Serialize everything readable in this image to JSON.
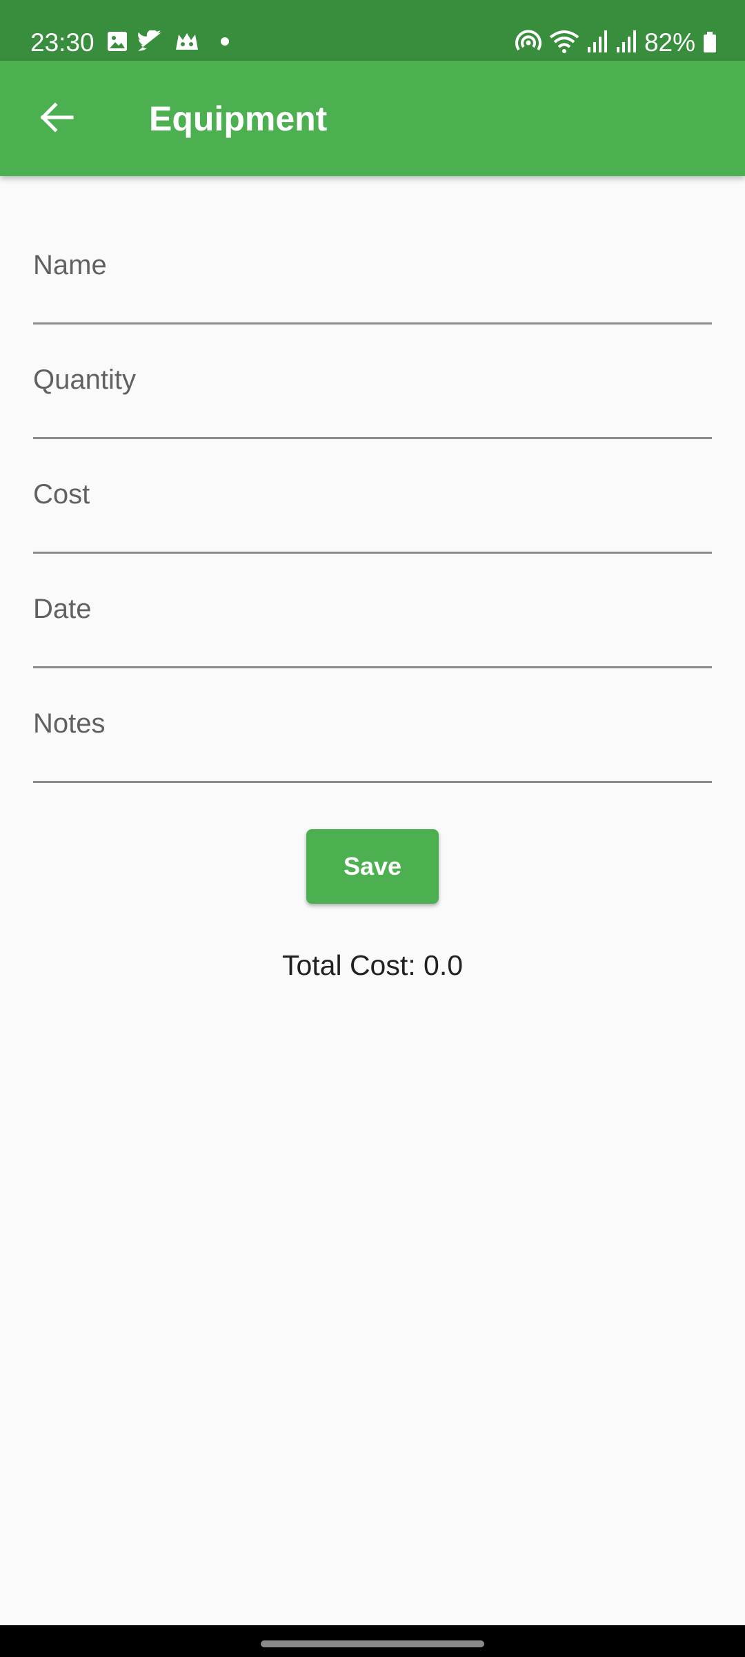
{
  "status_bar": {
    "time": "23:30",
    "battery_text": "82%",
    "icons_left": [
      "gallery-icon",
      "twitter-icon",
      "app-notification-icon",
      "dot-icon"
    ],
    "icons_right": [
      "hotspot-icon",
      "wifi-icon",
      "signal-icon",
      "signal-icon",
      "battery-icon"
    ]
  },
  "app_bar": {
    "title": "Equipment",
    "back_icon": "arrow-back-icon"
  },
  "form": {
    "fields": [
      {
        "label": "Name",
        "value": ""
      },
      {
        "label": "Quantity",
        "value": ""
      },
      {
        "label": "Cost",
        "value": ""
      },
      {
        "label": "Date",
        "value": ""
      },
      {
        "label": "Notes",
        "value": ""
      }
    ],
    "save_label": "Save",
    "total_cost": "Total Cost: 0.0"
  },
  "colors": {
    "status_bar": "#388e3c",
    "app_bar": "#4caf50",
    "accent": "#4caf50",
    "background": "#fafafa"
  }
}
